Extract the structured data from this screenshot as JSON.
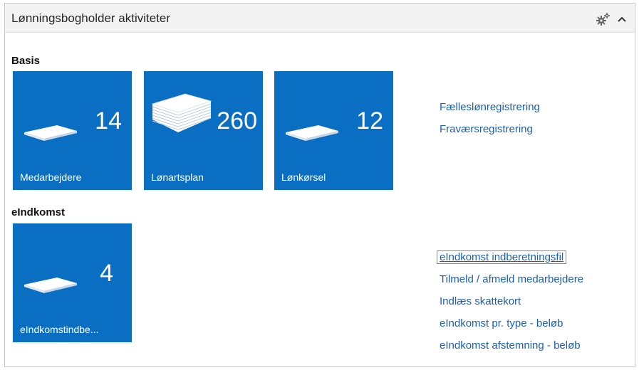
{
  "panel": {
    "title": "Lønningsbogholder aktiviteter",
    "icons": {
      "settings": "gear-icon",
      "collapse": "chevron-up-icon"
    }
  },
  "groups": [
    {
      "title": "Basis",
      "tiles": [
        {
          "label": "Medarbejdere",
          "count": "14",
          "icon": "small-stack-icon"
        },
        {
          "label": "Lønartsplan",
          "count": "260",
          "icon": "large-stack-icon"
        },
        {
          "label": "Lønkørsel",
          "count": "12",
          "icon": "small-stack-icon"
        }
      ],
      "links": [
        "Fælleslønregistrering",
        "Fraværsregistrering"
      ]
    },
    {
      "title": "eIndkomst",
      "tiles": [
        {
          "label": "eIndkomstindbe...",
          "count": "4",
          "icon": "small-stack-icon"
        }
      ],
      "links": [
        "eIndkomst indberetningsfil",
        "Tilmeld / afmeld medarbejdere",
        "Indlæs skattekort",
        "eIndkomst pr. type - beløb",
        "eIndkomst afstemning - beløb"
      ]
    }
  ],
  "colors": {
    "tile": "#0a6fc2",
    "link": "#1a5fb4",
    "header_bg": "#f3f3f3"
  }
}
